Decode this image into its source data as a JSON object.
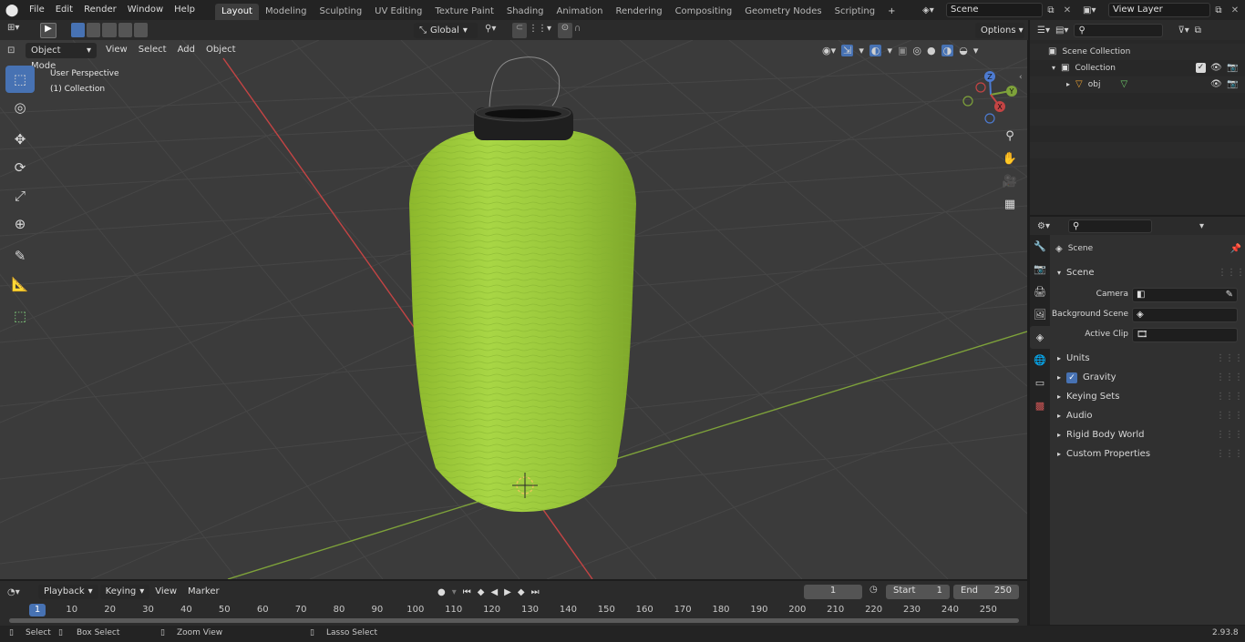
{
  "menu": {
    "items": [
      "File",
      "Edit",
      "Render",
      "Window",
      "Help"
    ]
  },
  "workspaces": [
    "Layout",
    "Modeling",
    "Sculpting",
    "UV Editing",
    "Texture Paint",
    "Shading",
    "Animation",
    "Rendering",
    "Compositing",
    "Geometry Nodes",
    "Scripting"
  ],
  "active_workspace": "Layout",
  "scene_field": "Scene",
  "view_layer_field": "View Layer",
  "viewport_header": {
    "mode": "Object Mode",
    "menus": [
      "View",
      "Select",
      "Add",
      "Object"
    ],
    "transform_orientation": "Global",
    "options": "Options"
  },
  "viewport": {
    "perspective": "User Perspective",
    "collection": "(1) Collection"
  },
  "gizmo_axes": {
    "z": "Z",
    "y": "Y",
    "x": "X"
  },
  "outliner": {
    "scene_collection": "Scene Collection",
    "collection": "Collection",
    "object": "obj"
  },
  "properties": {
    "breadcrumb": "Scene",
    "panel": "Scene",
    "camera_label": "Camera",
    "background_scene_label": "Background Scene",
    "active_clip_label": "Active Clip",
    "sections": [
      "Units",
      "Gravity",
      "Keying Sets",
      "Audio",
      "Rigid Body World",
      "Custom Properties"
    ],
    "gravity_enabled": true
  },
  "timeline": {
    "menus": [
      "Playback",
      "Keying",
      "View",
      "Marker"
    ],
    "current_frame": "1",
    "start_label": "Start",
    "start_value": "1",
    "end_label": "End",
    "end_value": "250",
    "ruler": [
      "1",
      "10",
      "20",
      "30",
      "40",
      "50",
      "60",
      "70",
      "80",
      "90",
      "100",
      "110",
      "120",
      "130",
      "140",
      "150",
      "160",
      "170",
      "180",
      "190",
      "200",
      "210",
      "220",
      "230",
      "240",
      "250"
    ]
  },
  "statusbar": {
    "select": "Select",
    "box_select": "Box Select",
    "zoom_view": "Zoom View",
    "lasso_select": "Lasso Select",
    "version": "2.93.8"
  },
  "colors": {
    "accent": "#4772b3",
    "lantern": "#9fcc3b",
    "x_axis": "#c44444",
    "y_axis": "#7ea23a"
  }
}
